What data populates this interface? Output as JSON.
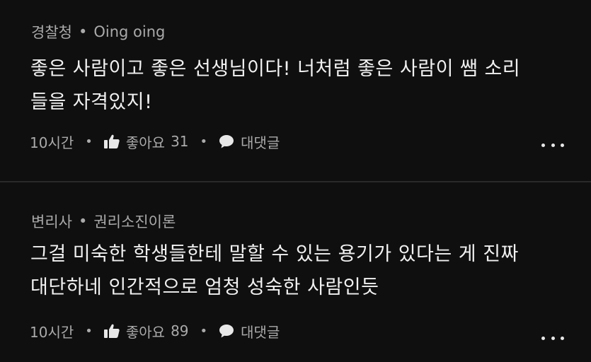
{
  "comments": [
    {
      "author": "경찰청",
      "subtitle": "Oing oing",
      "separator": "•",
      "lines": [
        "좋은 사람이고 좋은 선생님이다! 너처럼 좋은 사람이 쌤 소리",
        "들을 자격있지!"
      ],
      "time": "10시간",
      "like_label": "좋아요",
      "like_count": "31",
      "reply_label": "대댓글"
    },
    {
      "author": "변리사",
      "subtitle": "권리소진이론",
      "separator": "•",
      "lines": [
        "그걸 미숙한 학생들한테 말할 수 있는 용기가 있다는 게 진짜",
        "대단하네 인간적으로 엄청 성숙한 사람인듯"
      ],
      "time": "10시간",
      "like_label": "좋아요",
      "like_count": "89",
      "reply_label": "대댓글"
    }
  ],
  "action_separator": "•",
  "icons": {
    "like": "thumbs-up-icon",
    "reply": "speech-bubble-icon",
    "more": "more-dots-icon"
  },
  "colors": {
    "background": "#0f0f0f",
    "primary_text": "#f1f1f1",
    "secondary_text": "#aaaaaa",
    "divider": "#2a2a2a"
  }
}
